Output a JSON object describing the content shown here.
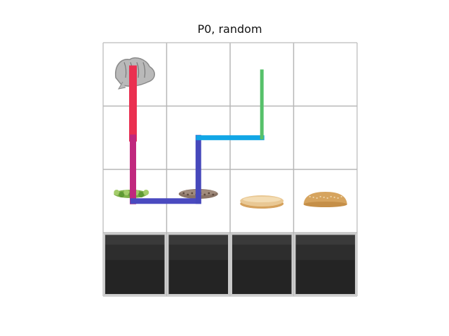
{
  "title": "P0, random",
  "grid": {
    "rows": 4,
    "cols": 4,
    "line_color": "#b7b7b7",
    "border_color": "#c6c6c6",
    "cells": [
      [
        "glove",
        null,
        null,
        null
      ],
      [
        null,
        null,
        null,
        null
      ],
      [
        "lettuce",
        "patty",
        "bun-bottom",
        "bun-top"
      ],
      [
        "counter",
        "counter",
        "counter",
        "counter"
      ]
    ]
  },
  "path": {
    "cells": [
      [
        2,
        4
      ],
      [
        2,
        2
      ],
      [
        3,
        2
      ],
      [
        4,
        2
      ],
      [
        5,
        2
      ],
      [
        5,
        4
      ],
      [
        6,
        4
      ],
      [
        8,
        4
      ],
      [
        8,
        2
      ]
    ],
    "colors": [
      "#ea3050",
      "#c0287e",
      "#4a4ac0",
      "#4a4ac0",
      "#4648bb",
      "#4a52c2",
      "#11a6e6",
      "#57c16a"
    ]
  },
  "colors": {
    "counter_dark": "#242424",
    "counter_band": "#3a3a3a",
    "counter_frame": "#c9c9c9",
    "lettuce": "#7fb04a",
    "patty": "#8a7466",
    "bun": "#e9c894",
    "bun_crust": "#d5a15c",
    "glove": "#b9b9b9"
  }
}
